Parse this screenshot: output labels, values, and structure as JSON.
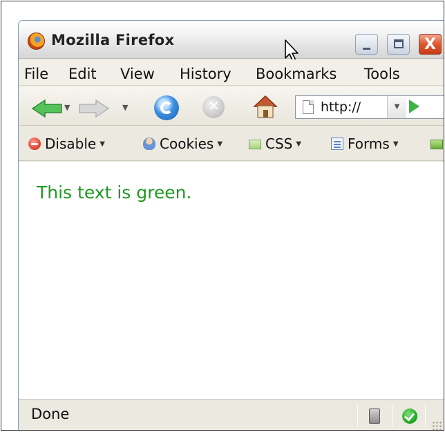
{
  "window": {
    "title": "Mozilla Firefox",
    "close_glyph": "X"
  },
  "menubar": {
    "items": [
      {
        "label": "File"
      },
      {
        "label": "Edit"
      },
      {
        "label": "View"
      },
      {
        "label": "History"
      },
      {
        "label": "Bookmarks"
      },
      {
        "label": "Tools"
      }
    ]
  },
  "navbar": {
    "url": "http://",
    "icons": [
      "back-arrow-icon",
      "forward-arrow-icon",
      "reload-icon",
      "stop-icon",
      "home-icon",
      "page-icon",
      "go-icon"
    ]
  },
  "devbar": {
    "items": [
      {
        "label": "Disable",
        "icon": "disable-icon"
      },
      {
        "label": "Cookies",
        "icon": "cookies-icon"
      },
      {
        "label": "CSS",
        "icon": "css-icon"
      },
      {
        "label": "Forms",
        "icon": "forms-icon"
      }
    ]
  },
  "content": {
    "text": "This text is green.",
    "text_color": "#1f9a1f"
  },
  "statusbar": {
    "text": "Done"
  }
}
